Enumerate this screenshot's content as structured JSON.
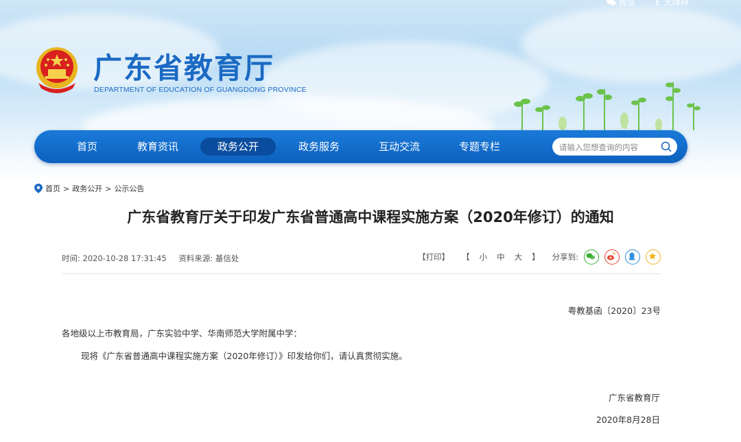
{
  "header": {
    "top_links": [
      "微信",
      "无障碍"
    ],
    "site_title": "广东省教育厅",
    "site_subtitle": "DEPARTMENT OF EDUCATION OF GUANGDONG PROVINCE"
  },
  "nav": {
    "items": [
      "首页",
      "教育资讯",
      "政务公开",
      "政务服务",
      "互动交流",
      "专题专栏"
    ],
    "active_index": 2,
    "search_placeholder": "请输入您想查询的内容"
  },
  "breadcrumb": {
    "items": [
      "首页",
      "政务公开",
      "公示公告"
    ],
    "separator": ">"
  },
  "article": {
    "title": "广东省教育厅关于印发广东省普通高中课程实施方案（2020年修订）的通知",
    "time_label": "时间: 2020-10-28 17:31:45",
    "source_label": "资料来源: 基信处",
    "print_label": "【打印】",
    "size_open": "【",
    "size_small": "小",
    "size_medium": "中",
    "size_large": "大",
    "size_close": "】",
    "share_label": "分享到:",
    "share_icons": [
      "wechat-icon",
      "weibo-icon",
      "qq-icon",
      "qzone-icon"
    ],
    "doc_number": "粤教基函〔2020〕23号",
    "addressee": "各地级以上市教育局，广东实验中学、华南师范大学附属中学：",
    "body": "现将《广东省普通高中课程实施方案（2020年修订）》印发给你们，请认真贯彻实施。",
    "signature_org": "广东省教育厅",
    "signature_date": "2020年8月28日"
  },
  "colors": {
    "brand_blue": "#1b6ac4",
    "nav_blue": "#0d61bf",
    "nav_active": "#0a4d9f"
  }
}
